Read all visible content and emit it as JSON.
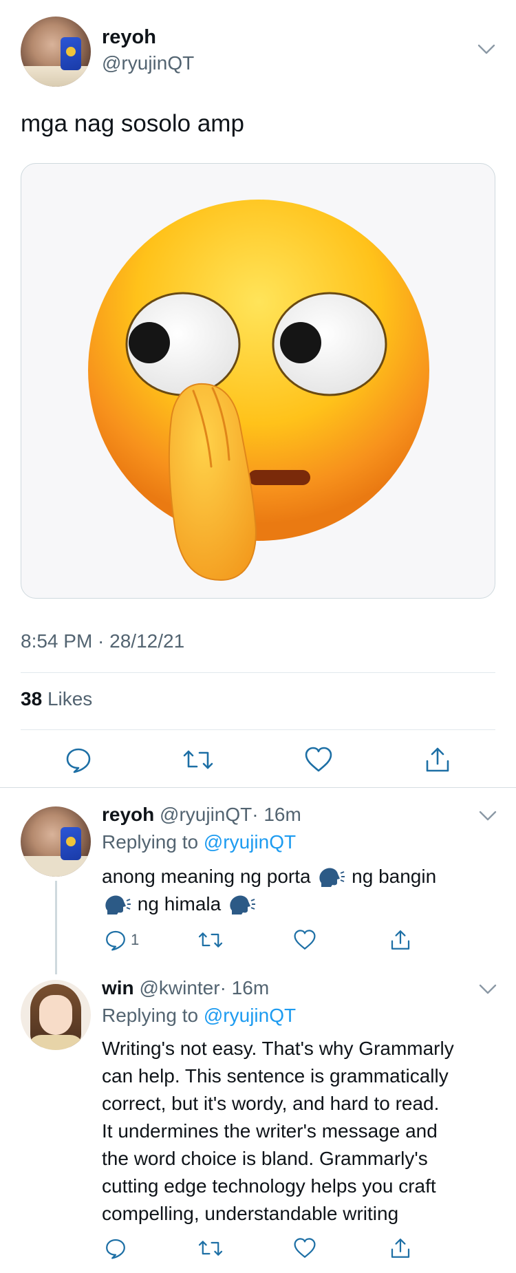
{
  "tweet": {
    "author_name": "reyoh",
    "author_handle": "@ryujinQT",
    "text": "mga nag sosolo amp",
    "timestamp": "8:54 PM · 28/12/21",
    "likes_count": "38",
    "likes_label": "Likes"
  },
  "replies": [
    {
      "name": "reyoh",
      "handle": "@ryujinQT",
      "time": "· 16m",
      "replying_prefix": "Replying to",
      "replying_to": "@ryujinQT",
      "line1": "anong meaning ng porta",
      "line1b": "ng bangin",
      "line2": "ng himala",
      "reply_count": "1"
    },
    {
      "name": "win",
      "handle": "@kwinter",
      "time": "· 16m",
      "replying_prefix": "Replying to",
      "replying_to": "@ryujinQT",
      "lines": [
        "Writing's not easy. That's why Grammarly",
        "can help. This sentence is grammatically",
        "correct, but it's wordy, and hard to read.",
        "It undermines the writer's message and",
        "the word choice is bland. Grammarly's",
        "cutting edge technology helps you craft",
        "compelling, understandable writing"
      ]
    }
  ],
  "icons": {
    "reply": "reply-icon",
    "retweet": "retweet-icon",
    "like": "heart-icon",
    "share": "share-icon",
    "more": "chevron-down-icon",
    "media_emoji": "face-with-hand-over-eye-emoji",
    "speaking_head": "speaking-head-emoji"
  },
  "colors": {
    "text_primary": "#0f1419",
    "text_secondary": "#536471",
    "link": "#1d9bf0",
    "divider": "#e1e8ed"
  }
}
